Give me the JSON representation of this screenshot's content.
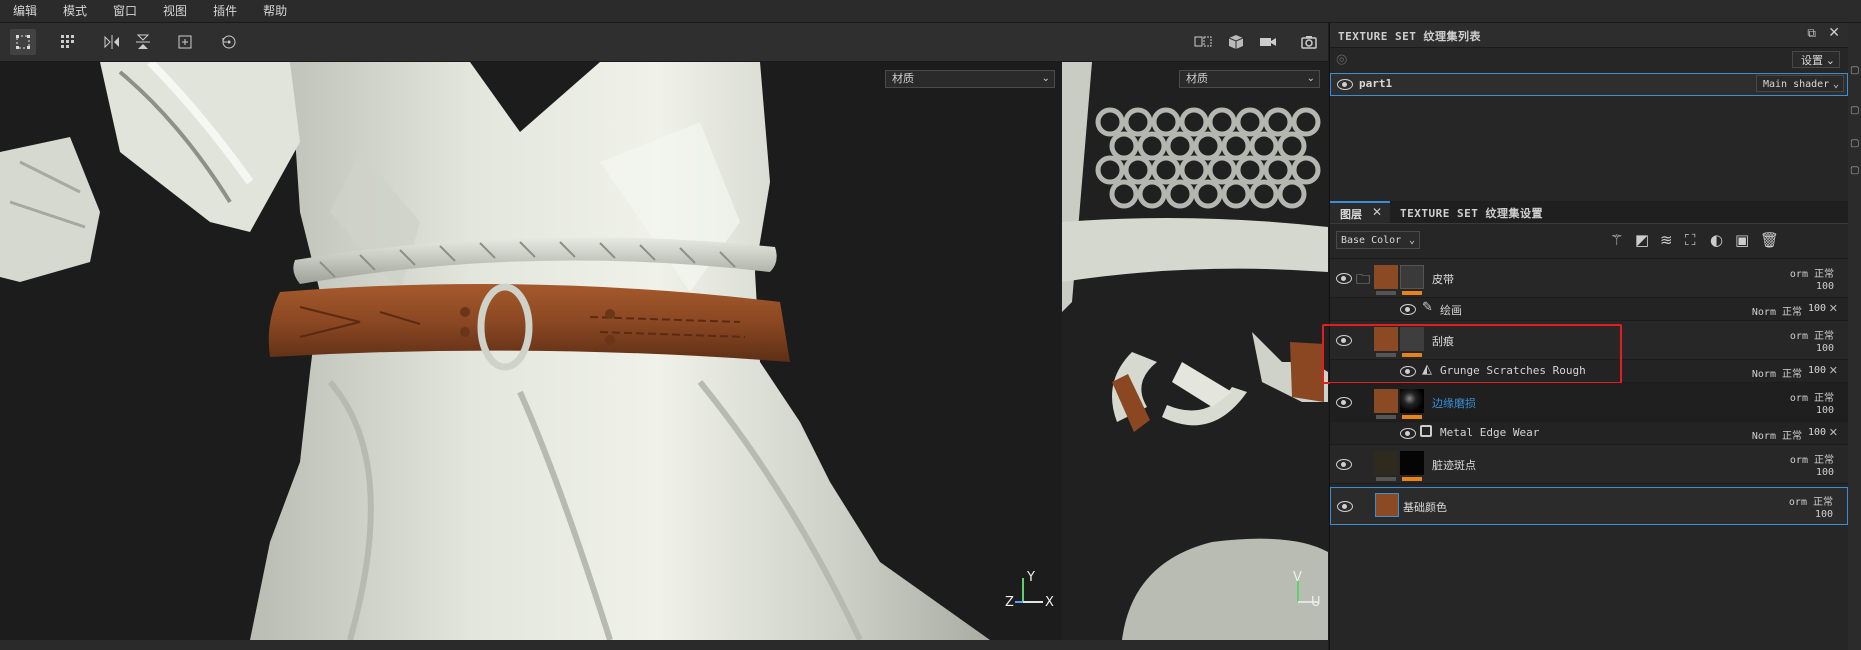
{
  "menu": [
    "编辑",
    "模式",
    "窗口",
    "视图",
    "插件",
    "帮助"
  ],
  "viewport3d": {
    "material_dropdown": "材质",
    "axis_labels": [
      "Y",
      "Z",
      "X"
    ]
  },
  "viewport2d": {
    "material_dropdown": "材质",
    "axis_labels": [
      "V",
      "U"
    ]
  },
  "texture_set_list": {
    "title": "TEXTURE SET 纹理集列表",
    "settings_label": "设置",
    "item_name": "part1",
    "shader": "Main shader"
  },
  "tabs": {
    "layers": "图层",
    "texture_set_settings": "TEXTURE SET 纹理集设置"
  },
  "channel_select": "Base Color",
  "layers": [
    {
      "name": "皮带",
      "blend": "orm 正常",
      "opacity": "100"
    },
    {
      "name": "绘画",
      "blend": "Norm 正常",
      "opacity": "100"
    },
    {
      "name": "刮痕",
      "blend": "orm 正常",
      "opacity": "100"
    },
    {
      "name": "Grunge Scratches Rough",
      "blend": "Norm 正常",
      "opacity": "100"
    },
    {
      "name": "边缘磨损",
      "blend": "orm 正常",
      "opacity": "100"
    },
    {
      "name": "Metal Edge Wear",
      "blend": "Norm 正常",
      "opacity": "100"
    },
    {
      "name": "脏迹斑点",
      "blend": "orm 正常",
      "opacity": "100"
    },
    {
      "name": "基础颜色",
      "blend": "orm 正常",
      "opacity": "100"
    }
  ],
  "colors": {
    "accent_blue": "#3a8fd6",
    "highlight_red": "#e02020",
    "leather": "#8b4a24",
    "cloth": "#d9dcd2"
  }
}
